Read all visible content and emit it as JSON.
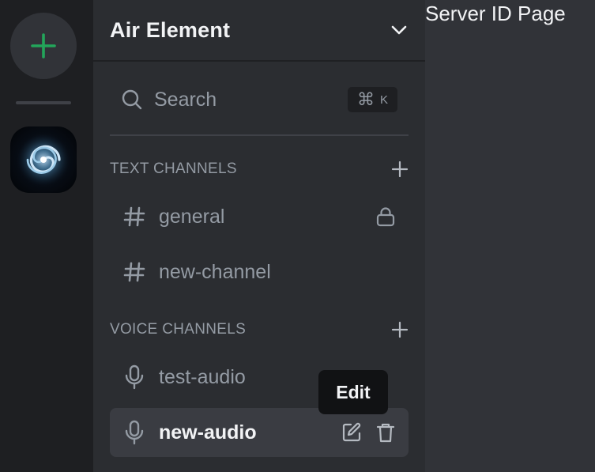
{
  "page": {
    "title": "Server ID Page"
  },
  "rail": {
    "add_server_icon": "plus-icon",
    "server": {
      "icon": "spiral-galaxy-server-icon"
    }
  },
  "sidebar": {
    "server_name": "Air Element",
    "header_icon": "chevron-down-icon",
    "search": {
      "label": "Search",
      "shortcut_symbol": "⌘",
      "shortcut_key": "K"
    },
    "text_channels": {
      "title": "TEXT CHANNELS",
      "channels": [
        {
          "name": "general",
          "icon": "hashtag-icon",
          "locked": true
        },
        {
          "name": "new-channel",
          "icon": "hashtag-icon",
          "locked": false
        }
      ]
    },
    "voice_channels": {
      "title": "VOICE CHANNELS",
      "channels": [
        {
          "name": "test-audio",
          "icon": "microphone-icon"
        },
        {
          "name": "new-audio",
          "icon": "microphone-icon",
          "active": true
        }
      ]
    },
    "tooltip": "Edit"
  },
  "colors": {
    "accent_green": "#23a55a",
    "rail_bg": "#1e1f22",
    "sidebar_bg": "#2b2d31",
    "main_bg": "#313338"
  }
}
